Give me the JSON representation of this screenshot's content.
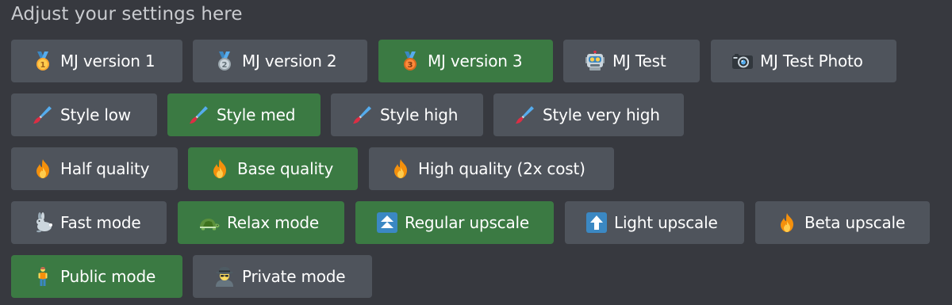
{
  "header": {
    "title": "Adjust your settings here"
  },
  "rows": [
    {
      "buttons": [
        {
          "label": "MJ version 1",
          "icon": "first-place-medal-icon",
          "style": "secondary"
        },
        {
          "label": "MJ version 2",
          "icon": "second-place-medal-icon",
          "style": "secondary"
        },
        {
          "label": "MJ version 3",
          "icon": "third-place-medal-icon",
          "style": "success"
        },
        {
          "label": "MJ Test",
          "icon": "robot-icon",
          "style": "secondary"
        },
        {
          "label": "MJ Test Photo",
          "icon": "camera-icon",
          "style": "secondary"
        }
      ]
    },
    {
      "buttons": [
        {
          "label": "Style low",
          "icon": "paintbrush-icon",
          "style": "secondary"
        },
        {
          "label": "Style med",
          "icon": "paintbrush-icon",
          "style": "success"
        },
        {
          "label": "Style high",
          "icon": "paintbrush-icon",
          "style": "secondary"
        },
        {
          "label": "Style very high",
          "icon": "paintbrush-icon",
          "style": "secondary"
        }
      ]
    },
    {
      "buttons": [
        {
          "label": "Half quality",
          "icon": "fire-icon",
          "style": "secondary"
        },
        {
          "label": "Base quality",
          "icon": "fire-icon",
          "style": "success"
        },
        {
          "label": "High quality (2x cost)",
          "icon": "fire-icon",
          "style": "secondary"
        }
      ]
    },
    {
      "buttons": [
        {
          "label": "Fast mode",
          "icon": "rabbit-icon",
          "style": "secondary"
        },
        {
          "label": "Relax mode",
          "icon": "turtle-icon",
          "style": "success"
        },
        {
          "label": "Regular upscale",
          "icon": "double-up-arrow-icon",
          "style": "success"
        },
        {
          "label": "Light upscale",
          "icon": "up-arrow-icon",
          "style": "secondary"
        },
        {
          "label": "Beta upscale",
          "icon": "fire-icon",
          "style": "secondary"
        }
      ]
    },
    {
      "buttons": [
        {
          "label": "Public mode",
          "icon": "person-standing-icon",
          "style": "success"
        },
        {
          "label": "Private mode",
          "icon": "detective-icon",
          "style": "secondary"
        }
      ]
    }
  ],
  "colors": {
    "background": "#37393f",
    "secondary_button": "#4f545c",
    "success_button": "#3b7a43",
    "header_text": "#c9cbcf",
    "button_text": "#ffffff"
  }
}
